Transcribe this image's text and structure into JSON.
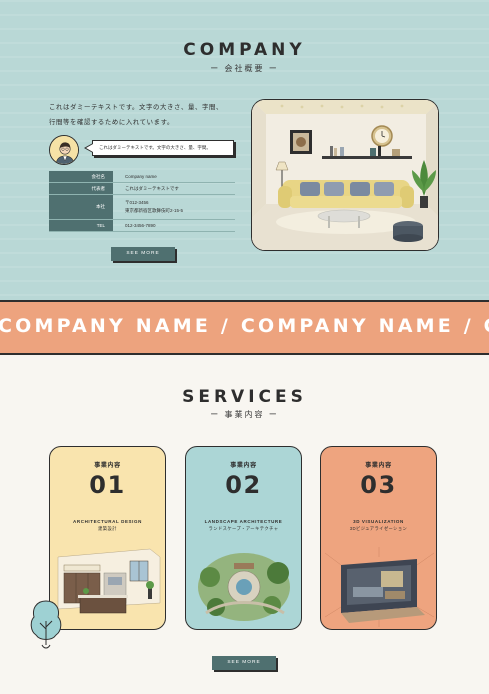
{
  "company": {
    "title": "COMPANY",
    "subtitle": "ー 会社概要 ー",
    "intro_line1": "これはダミーテキストです。文字の大きさ、量、字間、",
    "intro_line2": "行間等を確認するために入れています。",
    "bubble_text": "これはダミーテキストです。文字の大きさ、量、字間。",
    "info": [
      {
        "key": "会社名",
        "value": "Company name"
      },
      {
        "key": "代表者",
        "value": "これはダミーテキストです"
      },
      {
        "key": "本社",
        "value": "〒012-3456",
        "value2": "東京都新宿区歌舞伎町2-15-5"
      },
      {
        "key": "TEL",
        "value": "012-3456-7890"
      }
    ],
    "button_label": "SEE MORE"
  },
  "band": {
    "text": "COMPANY NAME / COMPANY NAME / COMPANY NAME"
  },
  "services": {
    "title": "SERVICES",
    "subtitle": "ー 事業内容 ー",
    "cards": [
      {
        "label": "事業内容",
        "number": "01",
        "en": "ARCHITECTURAL DESIGN",
        "jp": "建築設計",
        "color": "#f9e4ae"
      },
      {
        "label": "事業内容",
        "number": "02",
        "en": "LANDSCAPE ARCHITECTURE",
        "jp": "ランドスケープ・アーキテクチャ",
        "color": "#acd6d6"
      },
      {
        "label": "事業内容",
        "number": "03",
        "en": "3D VISUALIZATION",
        "jp": "3Dビジュアライゼーション",
        "color": "#eea47f"
      }
    ],
    "button_label": "SEE MORE"
  },
  "colors": {
    "mint": "#b9d8d6",
    "teal_dark": "#4f7070",
    "salmon": "#eda37e",
    "cream": "#f8f6f1",
    "ink": "#2e2e2e"
  }
}
